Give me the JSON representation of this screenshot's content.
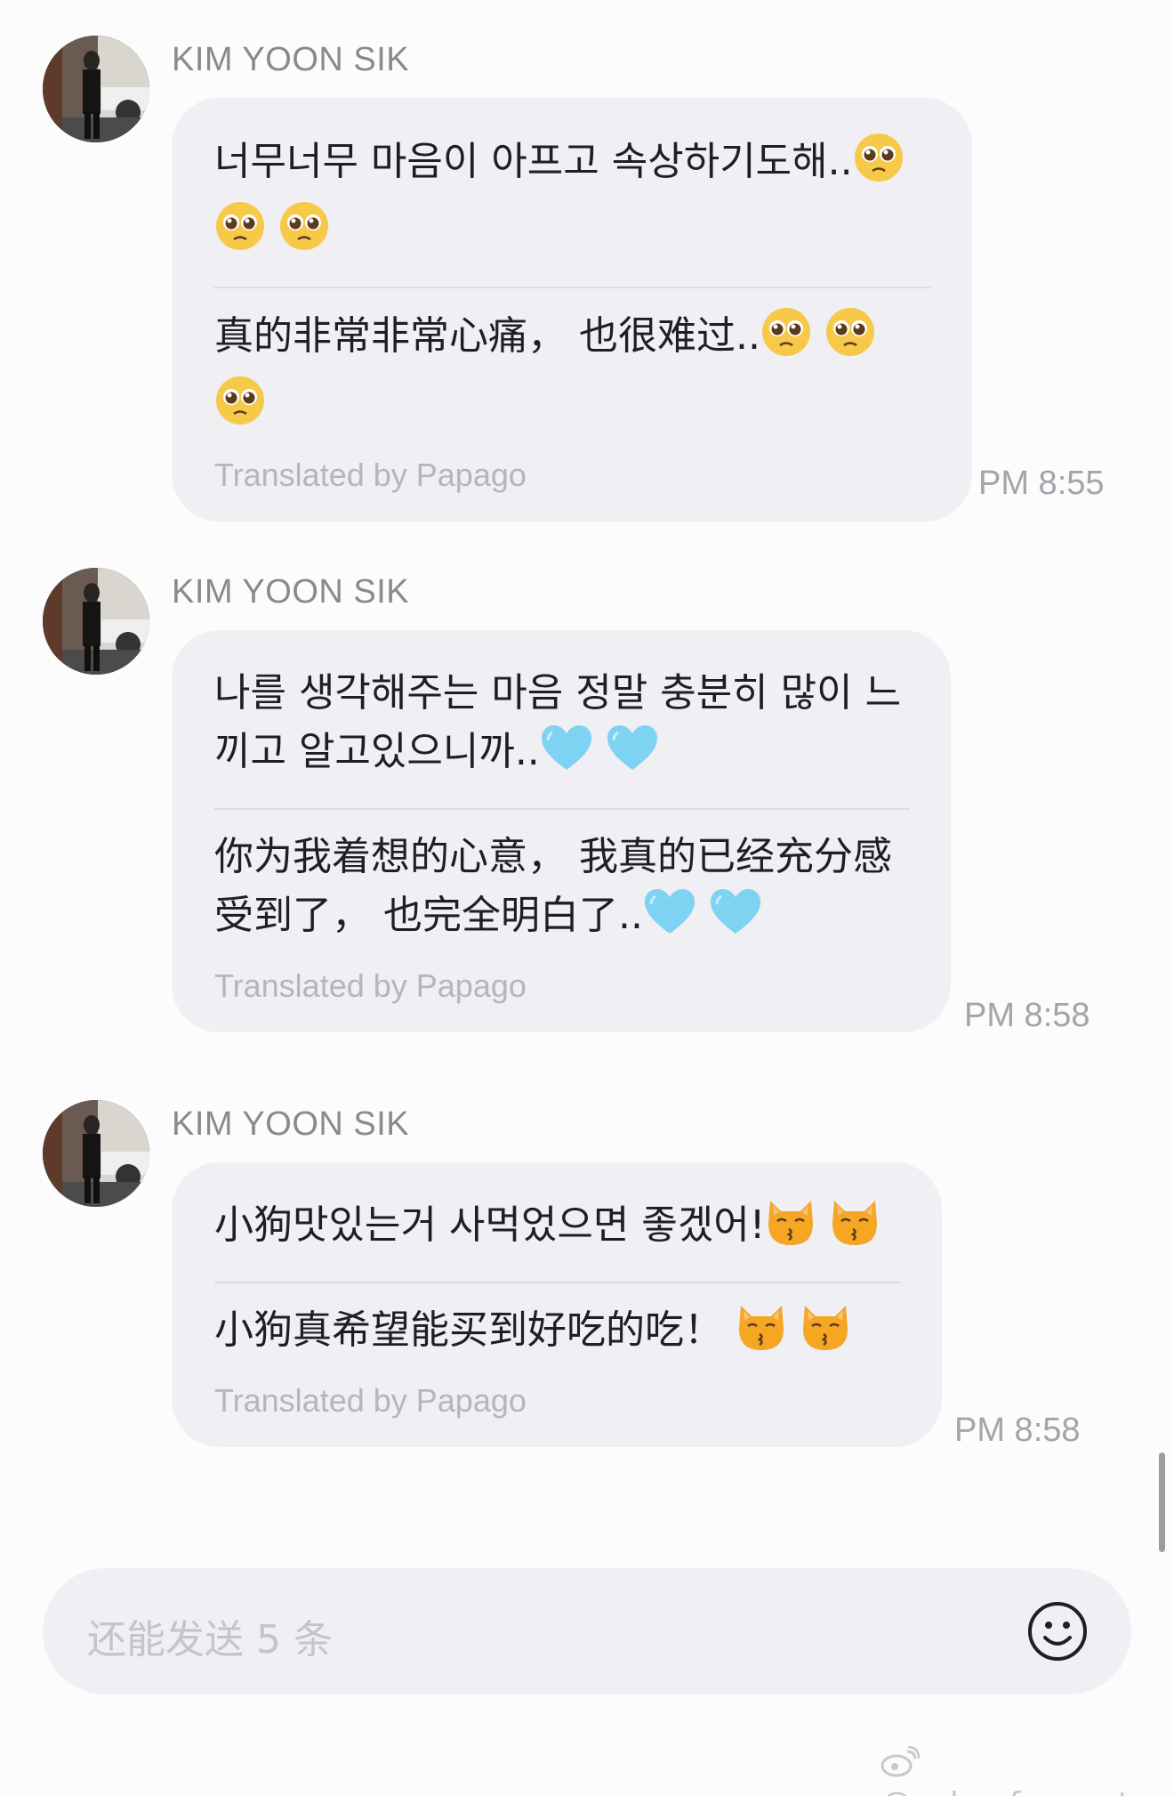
{
  "messages": [
    {
      "sender": "KIM YOON SIK",
      "original_text": "너무너무 마음이 아프고 속상하기도해..",
      "translated_text": "真的非常非常心痛， 也很难过..",
      "translator_note": "Translated by Papago",
      "time": "PM 8:55",
      "original_emoji": "pleading-face-emoji",
      "translated_emoji": "pleading-face-emoji"
    },
    {
      "sender": "KIM YOON SIK",
      "original_text": "나를 생각해주는 마음 정말 충분히 많이 느끼고 알고있으니까..",
      "translated_text": "你为我着想的心意， 我真的已经充分感受到了， 也完全明白了..",
      "translator_note": "Translated by Papago",
      "time": "PM 8:58",
      "original_emoji": "light-blue-heart-emoji",
      "translated_emoji": "light-blue-heart-emoji"
    },
    {
      "sender": "KIM YOON SIK",
      "original_text": "小狗맛있는거 사먹었으면 좋겠어!",
      "translated_text": "小狗真希望能买到好吃的吃！",
      "translator_note": "Translated by Papago",
      "time": "PM 8:58",
      "original_emoji": "kissing-cat-emoji",
      "translated_emoji": "kissing-cat-emoji"
    }
  ],
  "input": {
    "placeholder": "还能发送 5 条"
  },
  "watermark": "@echoofaugust",
  "colors": {
    "bubble": "#efeff4",
    "background": "#fcfcfd",
    "heart": "#7fd3f2",
    "emoji_face": "#f7c948"
  }
}
